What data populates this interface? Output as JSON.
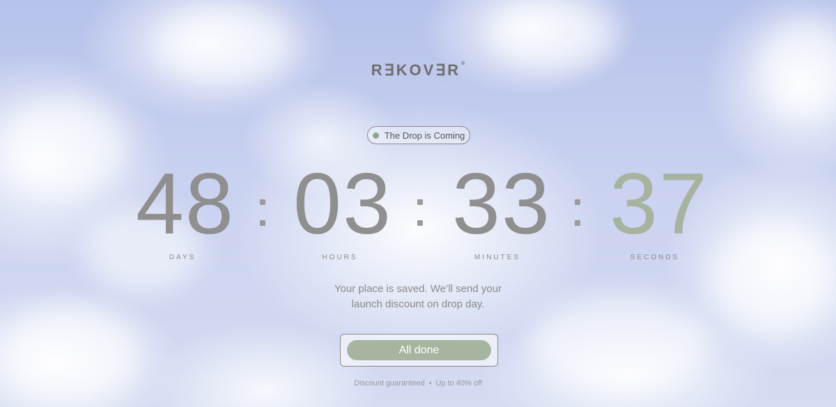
{
  "brand": {
    "logo_text": "R∃KOV∃R",
    "registered_mark": "®"
  },
  "status_pill": {
    "label": "The Drop is Coming",
    "dot_color": "#8fa58f"
  },
  "countdown": {
    "days": {
      "value": "48",
      "label": "DAYS"
    },
    "hours": {
      "value": "03",
      "label": "HOURS"
    },
    "minutes": {
      "value": "33",
      "label": "MINUTES"
    },
    "seconds": {
      "value": "37",
      "label": "SECONDS"
    }
  },
  "message": {
    "line1": "Your place is saved. We’ll send your",
    "line2": "launch discount on drop day."
  },
  "cta": {
    "label": "All done",
    "color": "#a6b5a0"
  },
  "footer": {
    "item1": "Discount guaranteed",
    "separator": "•",
    "item2": "Up to 40% off"
  },
  "colors": {
    "digits": "#8f8f8f",
    "seconds_digits": "#a5b39f",
    "sky": "#c4cfee"
  }
}
